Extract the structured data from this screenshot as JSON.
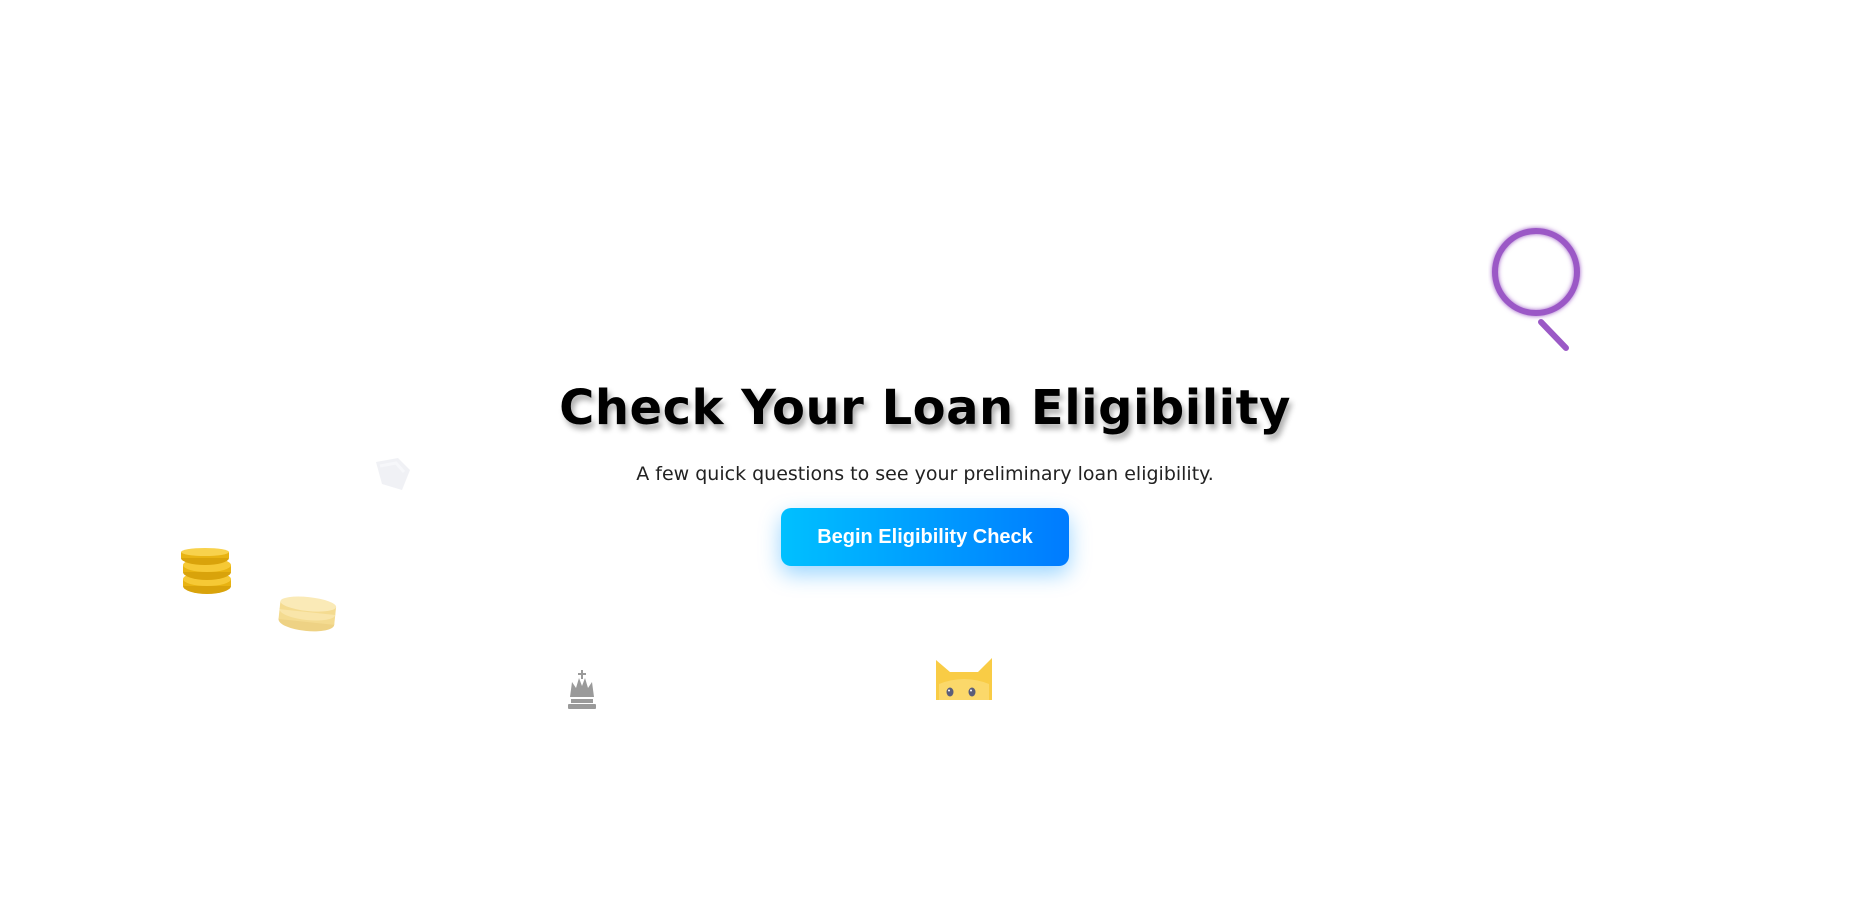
{
  "hero": {
    "title": "Check Your Loan Eligibility",
    "subtitle": "A few quick questions to see your preliminary loan eligibility.",
    "button_label": "Begin Eligibility Check"
  },
  "decorations": [
    {
      "icon": "magnifier-icon",
      "color": "#9b59c6"
    },
    {
      "icon": "coin-stack-icon",
      "color": "#f1c21b"
    },
    {
      "icon": "coin-stack-faded-icon",
      "color": "#f7d97a"
    },
    {
      "icon": "cat-icon",
      "color": "#f9cc45"
    },
    {
      "icon": "chess-king-icon",
      "color": "#9a9a9a"
    },
    {
      "icon": "paper-note-icon",
      "color": "#e6e6ee"
    }
  ],
  "colors": {
    "button_gradient_start": "#00c0ff",
    "button_gradient_end": "#007bff",
    "title": "#000000",
    "background": "#ffffff"
  }
}
